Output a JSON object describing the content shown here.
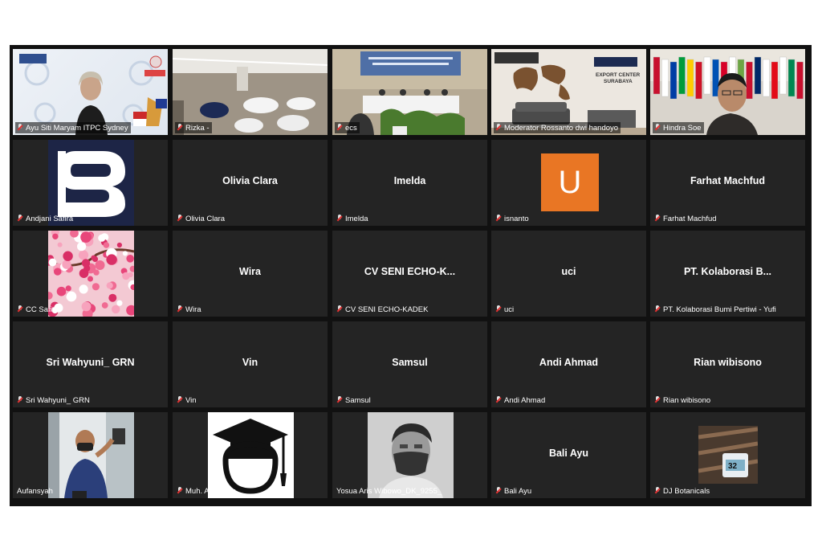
{
  "participants": [
    {
      "label": "Ayu Siti Maryam ITPC Sydney",
      "center": "",
      "muted": true,
      "kind": "video-ayu"
    },
    {
      "label": "Rizka -",
      "center": "",
      "muted": true,
      "kind": "video-hall"
    },
    {
      "label": "ecs",
      "center": "",
      "muted": true,
      "kind": "video-stage"
    },
    {
      "label": "Moderator Rossanto dwi handoyo",
      "center": "",
      "muted": true,
      "kind": "video-export"
    },
    {
      "label": "Hindra Soe",
      "center": "",
      "muted": true,
      "kind": "video-flags"
    },
    {
      "label": "Andjani Safira",
      "center": "",
      "muted": true,
      "kind": "logo-s"
    },
    {
      "label": "Olivia Clara",
      "center": "Olivia Clara",
      "muted": true,
      "kind": "name"
    },
    {
      "label": "Imelda",
      "center": "Imelda",
      "muted": true,
      "kind": "name"
    },
    {
      "label": "isnanto",
      "center": "",
      "muted": true,
      "kind": "avatar-u",
      "avatar_letter": "U"
    },
    {
      "label": "Farhat Machfud",
      "center": "Farhat Machfud",
      "muted": true,
      "kind": "name"
    },
    {
      "label": "CC Safitri",
      "center": "",
      "muted": true,
      "kind": "blossom"
    },
    {
      "label": "Wira",
      "center": "Wira",
      "muted": true,
      "kind": "name"
    },
    {
      "label": "CV SENI ECHO-KADEK",
      "center": "CV SENI ECHO-K...",
      "muted": true,
      "kind": "name"
    },
    {
      "label": "uci",
      "center": "uci",
      "muted": true,
      "kind": "name"
    },
    {
      "label": "PT. Kolaborasi Bumi Pertiwi - Yufi",
      "center": "PT. Kolaborasi B...",
      "muted": true,
      "kind": "name"
    },
    {
      "label": "Sri Wahyuni_ GRN",
      "center": "Sri Wahyuni_ GRN",
      "muted": true,
      "kind": "name"
    },
    {
      "label": "Vin",
      "center": "Vin",
      "muted": true,
      "kind": "name"
    },
    {
      "label": "Samsul",
      "center": "Samsul",
      "muted": true,
      "kind": "name"
    },
    {
      "label": "Andi Ahmad",
      "center": "Andi Ahmad",
      "muted": true,
      "kind": "name"
    },
    {
      "label": "Rian wibisono",
      "center": "Rian wibisono",
      "muted": true,
      "kind": "name"
    },
    {
      "label": "Aufansyah",
      "center": "",
      "muted": false,
      "kind": "photo-worker"
    },
    {
      "label": "Muh. Amin Bur",
      "center": "",
      "muted": true,
      "kind": "graduate"
    },
    {
      "label": "Yosua Aris Wibowo_DK_9255_",
      "center": "",
      "muted": false,
      "kind": "photo-mask"
    },
    {
      "label": "Bali Ayu",
      "center": "Bali Ayu",
      "muted": true,
      "kind": "name"
    },
    {
      "label": "DJ Botanicals",
      "center": "",
      "muted": true,
      "kind": "photo-thermo"
    }
  ],
  "active_speaker_index": 0,
  "export_sign": "EXPORT CENTER SURABAYA",
  "thermo_value": "32"
}
